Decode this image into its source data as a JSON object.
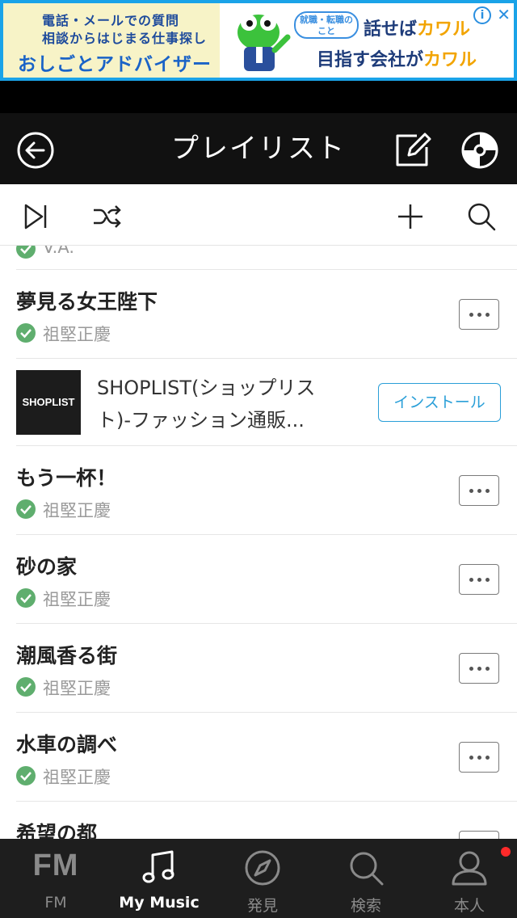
{
  "ad_banner": {
    "line1": "電話・メールでの質問",
    "line2": "相談からはじまる仕事探し",
    "line3": "おしごとアドバイザー",
    "bubble": "就職・転職のこと",
    "slogan1_main": "話せば",
    "slogan1_brand": "カワル",
    "slogan2_main": "目指す会社が",
    "slogan2_brand": "カワル",
    "info_glyph": "i",
    "close_glyph": "✕"
  },
  "header": {
    "title": "プレイリスト"
  },
  "playlist": {
    "partial_top_artist": "V.A.",
    "items": [
      {
        "title": "夢見る女王陛下",
        "artist": "祖堅正慶"
      },
      {
        "title": "もう一杯！",
        "artist": "祖堅正慶"
      },
      {
        "title": "砂の家",
        "artist": "祖堅正慶"
      },
      {
        "title": "潮風香る街",
        "artist": "祖堅正慶"
      },
      {
        "title": "水車の調べ",
        "artist": "祖堅正慶"
      },
      {
        "title": "希望の都",
        "artist": ""
      }
    ]
  },
  "inline_ad": {
    "logo_text": "SHOPLIST",
    "text_line1": "SHOPLIST(ショップリス",
    "text_line2": "ト)-ファッション通販...",
    "install_label": "インストール"
  },
  "bottom_nav": {
    "items": [
      {
        "label": "FM",
        "icon": "fm-icon",
        "icon_text": "FM",
        "active": false
      },
      {
        "label": "My Music",
        "icon": "music-note-icon",
        "active": true
      },
      {
        "label": "発見",
        "icon": "compass-icon",
        "active": false
      },
      {
        "label": "検索",
        "icon": "search-icon",
        "active": false
      },
      {
        "label": "本人",
        "icon": "person-icon",
        "active": false
      }
    ]
  },
  "colors": {
    "accent_blue": "#2a9fd8",
    "check_green": "#5fae6e",
    "header_bg": "#111111",
    "nav_bg": "#1e1e1e",
    "notification_red": "#ff2a2a"
  }
}
